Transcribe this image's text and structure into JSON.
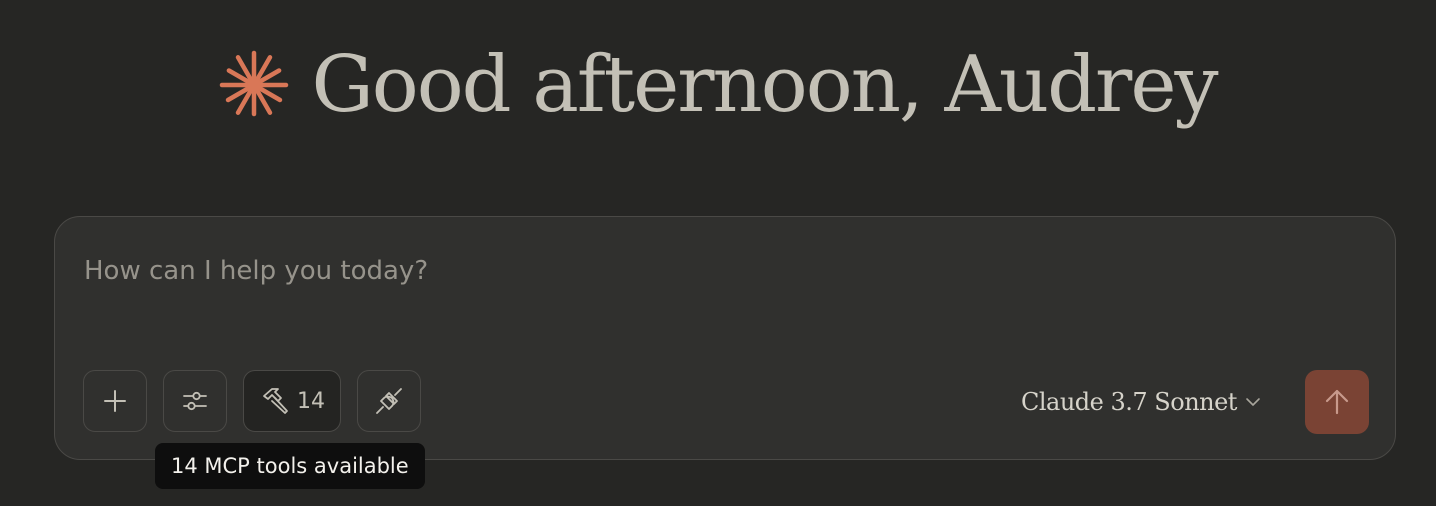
{
  "greeting": {
    "text": "Good afternoon, Audrey",
    "icon": "claude-spark-icon",
    "icon_color": "#d97757"
  },
  "composer": {
    "placeholder": "How can I help you today?",
    "value": ""
  },
  "toolbar": {
    "add_icon": "plus-icon",
    "options_icon": "sliders-icon",
    "tools_icon": "hammer-icon",
    "tools_count": "14",
    "connect_icon": "plug-icon"
  },
  "model_selector": {
    "label": "Claude 3.7 Sonnet",
    "icon": "chevron-down-icon"
  },
  "send_button": {
    "icon": "arrow-up-icon",
    "color": "#7a4334"
  },
  "tooltip": {
    "text": "14 MCP tools available"
  },
  "colors": {
    "background": "#262624",
    "composer": "#30302e",
    "accent": "#d97757"
  }
}
